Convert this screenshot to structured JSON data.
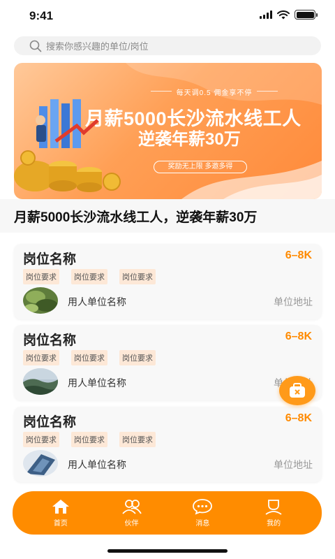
{
  "status_bar": {
    "time": "9:41"
  },
  "search": {
    "placeholder": "搜索你感兴趣的单位/岗位"
  },
  "banner": {
    "tagline": "每天调0.5 佣金享不停",
    "line1": "月薪5000长沙流水线工人",
    "line2": "逆袭年薪30万",
    "pill": "奖励无上限 多邀多得"
  },
  "headline": "月薪5000长沙流水线工人，逆袭年薪30万",
  "jobs": [
    {
      "title": "岗位名称",
      "salary": "6–8K",
      "tags": [
        "岗位要求",
        "岗位要求",
        "岗位要求"
      ],
      "company": "用人单位名称",
      "address": "单位地址"
    },
    {
      "title": "岗位名称",
      "salary": "6–8K",
      "tags": [
        "岗位要求",
        "岗位要求",
        "岗位要求"
      ],
      "company": "用人单位名称",
      "address": "单位地址"
    },
    {
      "title": "岗位名称",
      "salary": "6–8K",
      "tags": [
        "岗位要求",
        "岗位要求",
        "岗位要求"
      ],
      "company": "用人单位名称",
      "address": "单位地址"
    }
  ],
  "tabs": [
    {
      "label": "首页",
      "icon": "home-icon",
      "active": true
    },
    {
      "label": "伙伴",
      "icon": "partners-icon",
      "active": false
    },
    {
      "label": "消息",
      "icon": "message-icon",
      "active": false
    },
    {
      "label": "我的",
      "icon": "profile-icon",
      "active": false
    }
  ],
  "colors": {
    "accent": "#ff8c00",
    "salary": "#ff8a00",
    "tag_bg": "#fde8d7"
  }
}
